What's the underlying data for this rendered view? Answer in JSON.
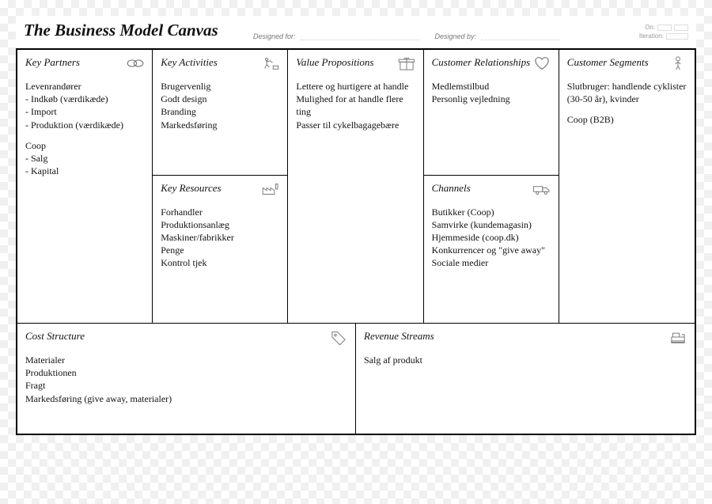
{
  "header": {
    "title": "The Business Model Canvas",
    "designed_for_label": "Designed for:",
    "designed_by_label": "Designed by:",
    "on_label": "On:",
    "iteration_label": "Iteration:"
  },
  "blocks": {
    "key_partners": {
      "title": "Key Partners",
      "lines": [
        "Levenrandører",
        "- Indkøb (værdikæde)",
        "- Import",
        "- Produktion (værdikæde)",
        "",
        "Coop",
        "- Salg",
        "- Kapital"
      ]
    },
    "key_activities": {
      "title": "Key Activities",
      "lines": [
        "Brugervenlig",
        "Godt design",
        "Branding",
        "Markedsføring"
      ]
    },
    "key_resources": {
      "title": "Key Resources",
      "lines": [
        "Forhandler",
        "Produktionsanlæg",
        "Maskiner/fabrikker",
        "Penge",
        "Kontrol tjek"
      ]
    },
    "value_propositions": {
      "title": "Value Propositions",
      "lines": [
        "Lettere og hurtigere at handle",
        "Mulighed for at handle flere ting",
        "Passer til cykelbagagebære"
      ]
    },
    "customer_relationships": {
      "title": "Customer Relationships",
      "lines": [
        "Medlemstilbud",
        "Personlig vejledning"
      ]
    },
    "channels": {
      "title": "Channels",
      "lines": [
        "Butikker (Coop)",
        "Samvirke (kundemagasin)",
        "Hjemmeside (coop.dk)",
        "Konkurrencer og \"give away\"",
        "Sociale medier"
      ]
    },
    "customer_segments": {
      "title": "Customer Segments",
      "lines": [
        "Slutbruger: handlende cyklister (30-50 år), kvinder",
        "",
        "Coop (B2B)"
      ]
    },
    "cost_structure": {
      "title": "Cost Structure",
      "lines": [
        "Materialer",
        "Produktionen",
        "Fragt",
        "Markedsføring (give away, materialer)"
      ]
    },
    "revenue_streams": {
      "title": "Revenue Streams",
      "lines": [
        "Salg af produkt"
      ]
    }
  }
}
